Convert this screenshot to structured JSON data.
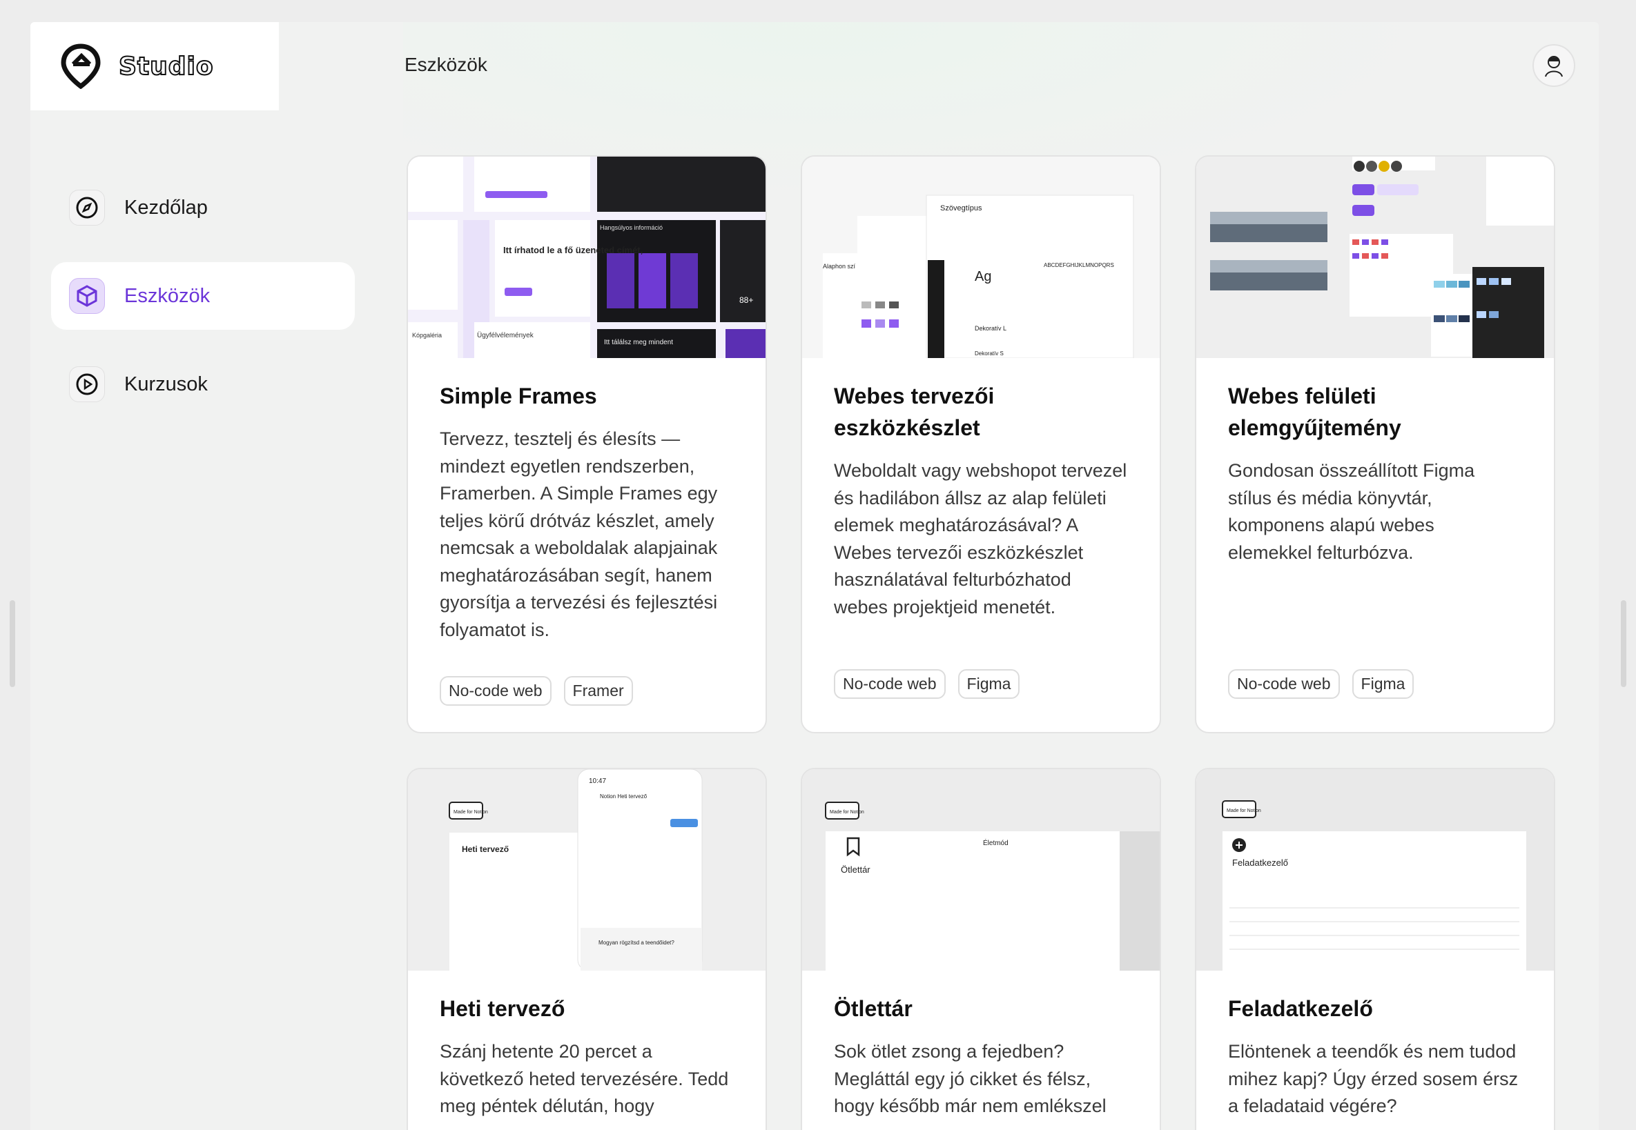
{
  "brand": {
    "name": "Studio"
  },
  "header": {
    "title": "Eszközök"
  },
  "sidebar": {
    "items": [
      {
        "label": "Kezdőlap",
        "icon": "compass-icon"
      },
      {
        "label": "Eszközök",
        "icon": "cube-icon",
        "active": true
      },
      {
        "label": "Kurzusok",
        "icon": "play-circle-icon"
      }
    ]
  },
  "colors": {
    "accent": "#6b35d9",
    "accent_light": "#e7dcfb"
  },
  "cards": [
    {
      "title": "Simple Frames",
      "description": "Tervezz, tesztelj és élesíts — mindezt egyetlen rendszerben, Framerben. A Simple Frames egy teljes körű drótváz készlet, amely nemcsak a weboldalak alapjainak meghatározásában segít, hanem gyorsítja a tervezési és fejlesztési folyamatot is.",
      "tags": [
        "No-code web",
        "Framer"
      ],
      "thumb": {
        "t1": "Hangsúlyos információ",
        "t2": "Itt írhatod le a fő üzeneted címét,",
        "t3": "Ügyfélvélemények",
        "t4": "Itt tálálsz meg mindent",
        "t5": "88+",
        "t6": "Kópgaléria"
      }
    },
    {
      "title": "Webes tervezői eszközkészlet",
      "description": "Weboldalt vagy webshopot tervezel és hadilábon állsz az alap felületi elemek meghatározásával? A Webes tervezői eszközkészlet használatával felturbózhatod webes projektjeid menetét.",
      "tags": [
        "No-code web",
        "Figma"
      ],
      "thumb": {
        "t1": "Szövegtípus",
        "t2": "Ag",
        "t3": "Dekoratív L",
        "t4": "Alaphon szí",
        "t5": "ABCDEFGHIJKLMNOPQRS",
        "t6": "Dekoratív S"
      }
    },
    {
      "title": "Webes felületi elemgyűjtemény",
      "description": "Gondosan összeállított Figma stílus és média könyvtár, komponens alapú webes elemekkel felturbózva.",
      "tags": [
        "No-code web",
        "Figma"
      ],
      "thumb": {}
    },
    {
      "title": "Heti tervező",
      "description": "Szánj hetente 20 percet a következő heted tervezésére. Tedd meg péntek délután, hogy",
      "tags": [],
      "thumb": {
        "t1": "Made for Notion",
        "t2": "Heti tervező",
        "t3": "10:47",
        "t4": "Notion Heti tervező",
        "t5": "Mogyan rögzítsd a teendőidet?"
      }
    },
    {
      "title": "Ötlettár",
      "description": "Sok ötlet zsong a fejedben? Megláttál egy jó cikket és félsz, hogy később már nem emlékszel",
      "tags": [],
      "thumb": {
        "t1": "Made for Notion",
        "t2": "Ötlettár",
        "t3": "Életmód"
      }
    },
    {
      "title": "Feladatkezelő",
      "description": "Elöntenek a teendők és nem tudod mihez kapj? Úgy érzed sosem érsz a feladataid végére?",
      "tags": [],
      "thumb": {
        "t1": "Made for Notion",
        "t2": "Feladatkezelő"
      }
    }
  ]
}
